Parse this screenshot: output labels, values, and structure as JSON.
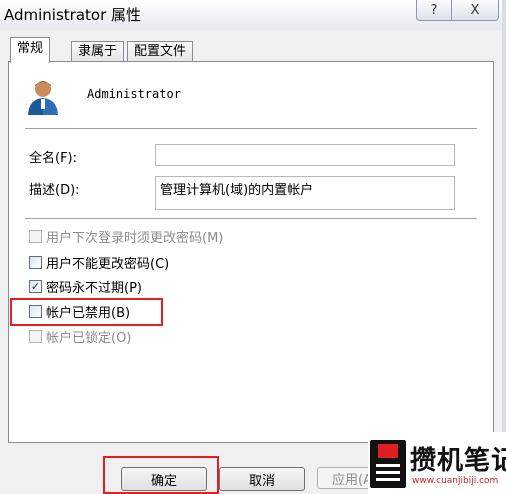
{
  "window": {
    "title": "Administrator 属性",
    "help_label": "?",
    "close_label": "X"
  },
  "tabs": [
    {
      "label": "常规",
      "active": true
    },
    {
      "label": "隶属于",
      "active": false
    },
    {
      "label": "配置文件",
      "active": false
    }
  ],
  "general": {
    "username": "Administrator",
    "fullname": {
      "label": "全名(F):",
      "value": ""
    },
    "description": {
      "label": "描述(D):",
      "value": "管理计算机(域)的内置帐户"
    },
    "checkboxes": [
      {
        "label": "用户下次登录时须更改密码(M)",
        "checked": false,
        "enabled": false
      },
      {
        "label": "用户不能更改密码(C)",
        "checked": false,
        "enabled": true
      },
      {
        "label": "密码永不过期(P)",
        "checked": true,
        "enabled": true
      },
      {
        "label": "帐户已禁用(B)",
        "checked": false,
        "enabled": true,
        "highlighted": true
      },
      {
        "label": "帐户已锁定(O)",
        "checked": false,
        "enabled": false
      }
    ],
    "check_mark": "✓"
  },
  "buttons": {
    "ok": "确定",
    "cancel": "取消",
    "apply": "应用(A)"
  },
  "watermark": {
    "title": "攒机笔记",
    "url": "www.cuanjibiji.com"
  },
  "colors": {
    "highlight_red": "#e02020",
    "panel_bg": "#ffffff",
    "window_bg": "#f0f0f0"
  }
}
